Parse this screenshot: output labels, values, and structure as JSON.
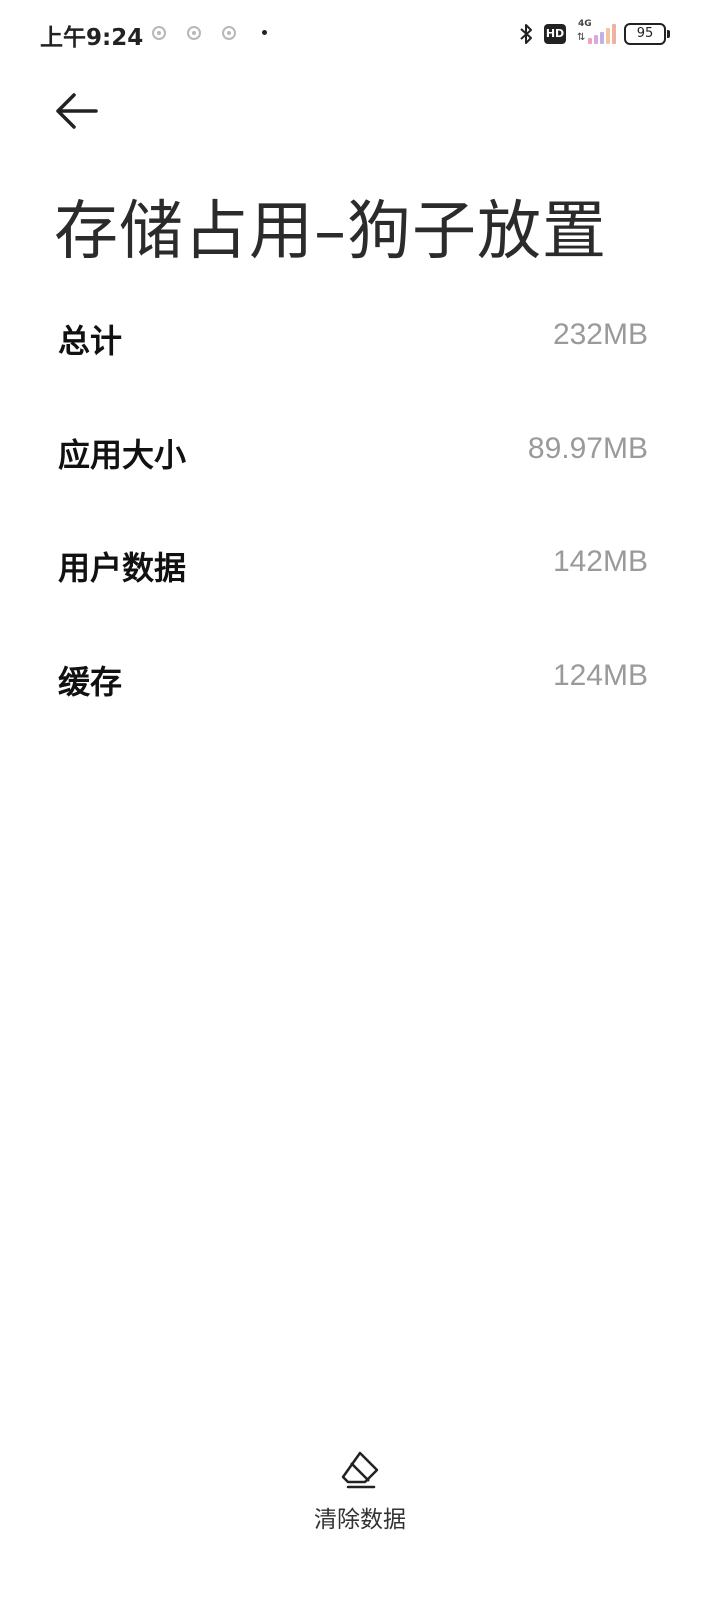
{
  "status_bar": {
    "time": "上午9:24",
    "network": "4G",
    "hd": "HD",
    "battery": "95",
    "icons": [
      "notification-icon",
      "notification-icon",
      "notification-icon",
      "bluetooth-icon",
      "hd-icon",
      "signal-icon",
      "battery-icon"
    ]
  },
  "header": {
    "back_icon": "back-arrow-icon",
    "title": "存储占用–狗子放置"
  },
  "storage": {
    "rows": [
      {
        "label": "总计",
        "value": "232MB"
      },
      {
        "label": "应用大小",
        "value": "89.97MB"
      },
      {
        "label": "用户数据",
        "value": "142MB"
      },
      {
        "label": "缓存",
        "value": "124MB"
      }
    ]
  },
  "actions": {
    "clear_data_icon": "eraser-icon",
    "clear_data_label": "清除数据"
  },
  "colors": {
    "background": "#ffffff",
    "label": "#111111",
    "value": "#9a9a9a"
  }
}
